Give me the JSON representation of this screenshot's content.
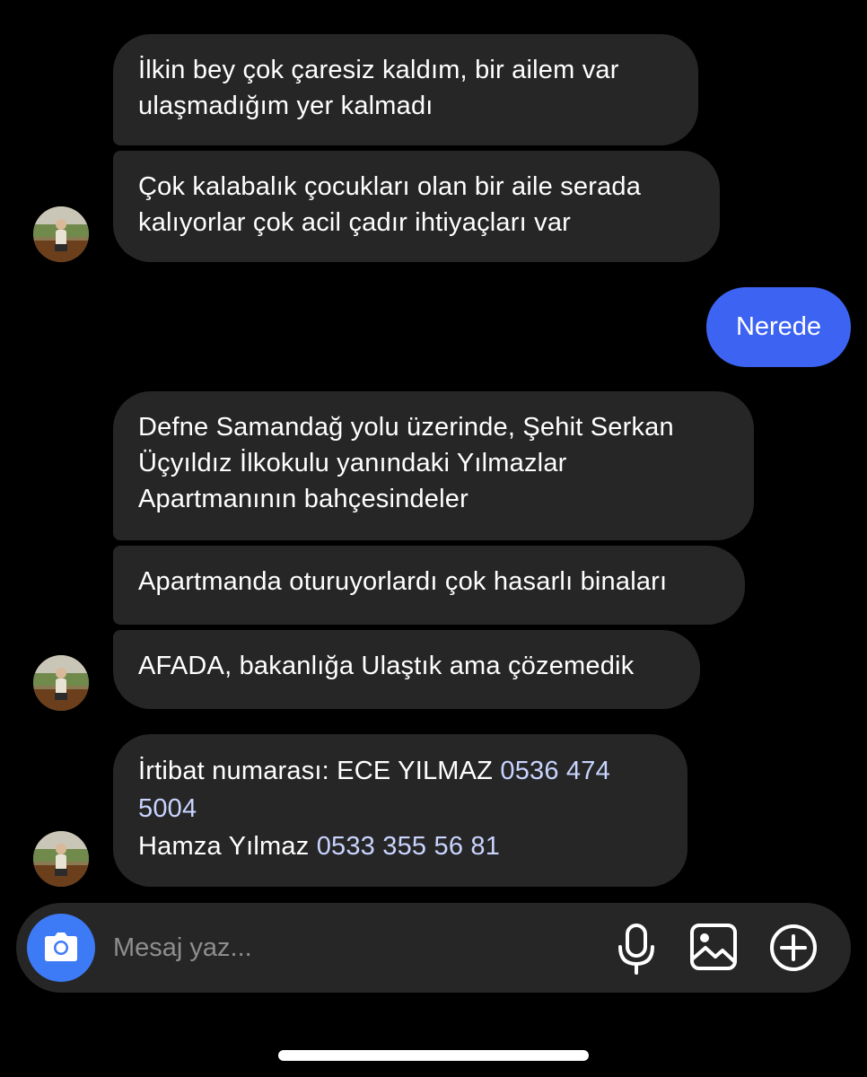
{
  "messages": {
    "m1": [
      "İlkin bey çok çaresiz kaldım, bir ailem var",
      "ulaşmadığım yer kalmadı"
    ],
    "m2": [
      "Çok kalabalık çocukları olan bir aile serada",
      "kalıyorlar çok acil çadır ihtiyaçları var"
    ],
    "outgoing": "Nerede",
    "m3": [
      "Defne Samandağ yolu üzerinde, Şehit Serkan",
      "Üçyıldız İlkokulu yanındaki Yılmazlar",
      "Apartmanının bahçesindeler"
    ],
    "m4": "Apartmanda oturuyorlardı çok hasarlı binaları",
    "m5": "AFADA, bakanlığa Ulaştık ama çözemedik",
    "m6": {
      "line1_text": "İrtibat numarası: ECE YILMAZ ",
      "line1_phone": "0536 474",
      "line2_phone": "5004",
      "line3_text": "Hamza Yılmaz ",
      "line3_phone": "0533 355 56 81"
    }
  },
  "composer": {
    "placeholder": "Mesaj yaz...",
    "icons": [
      "camera-icon",
      "microphone-icon",
      "photo-gallery-icon",
      "plus-circle-icon"
    ]
  },
  "colors": {
    "background": "#000000",
    "incoming_bubble": "#262626",
    "outgoing_bubble": "#3d63f2",
    "camera_button": "#3d7af5",
    "placeholder_text": "#8e8e8e"
  }
}
